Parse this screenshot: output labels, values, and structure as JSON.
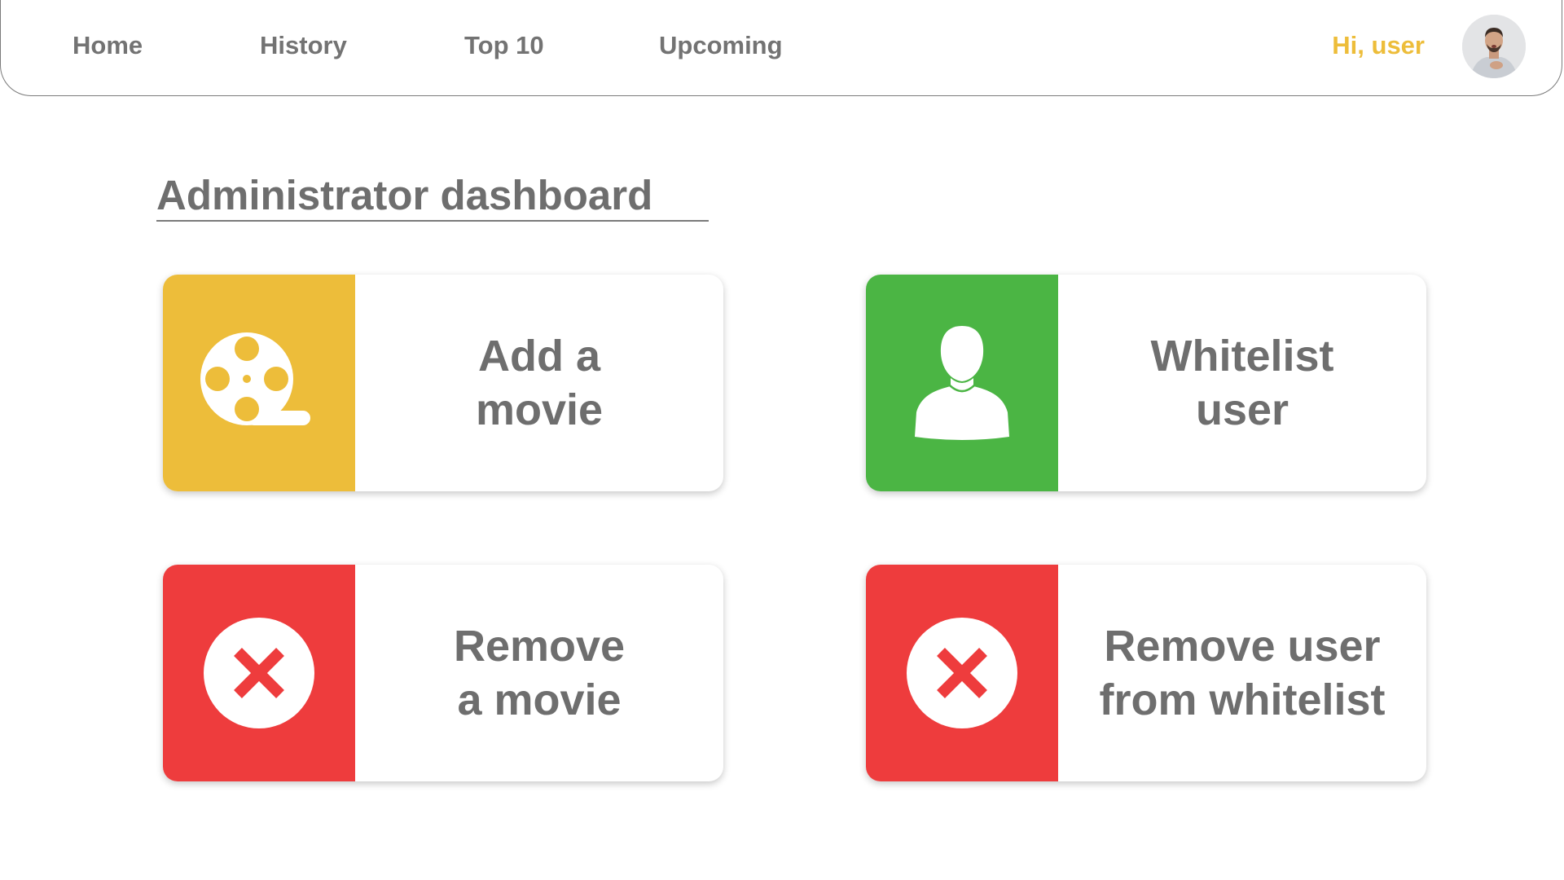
{
  "nav": {
    "links": [
      {
        "label": "Home"
      },
      {
        "label": "History"
      },
      {
        "label": "Top 10"
      },
      {
        "label": "Upcoming"
      }
    ],
    "greeting": "Hi, user"
  },
  "page": {
    "title": "Administrator dashboard"
  },
  "cards": [
    {
      "label": "Add a\nmovie",
      "icon": "film-reel-icon",
      "color": "#edbd3a"
    },
    {
      "label": "Whitelist\nuser",
      "icon": "user-silhouette-icon",
      "color": "#4bb544"
    },
    {
      "label": "Remove\na movie",
      "icon": "close-circle-icon",
      "color": "#ee3c3d"
    },
    {
      "label": "Remove user\nfrom whitelist",
      "icon": "close-circle-icon",
      "color": "#ee3c3d"
    }
  ],
  "colors": {
    "accent_yellow": "#edbd3a",
    "accent_green": "#4bb544",
    "accent_red": "#ee3c3d",
    "text_gray": "#6e6e6e"
  }
}
